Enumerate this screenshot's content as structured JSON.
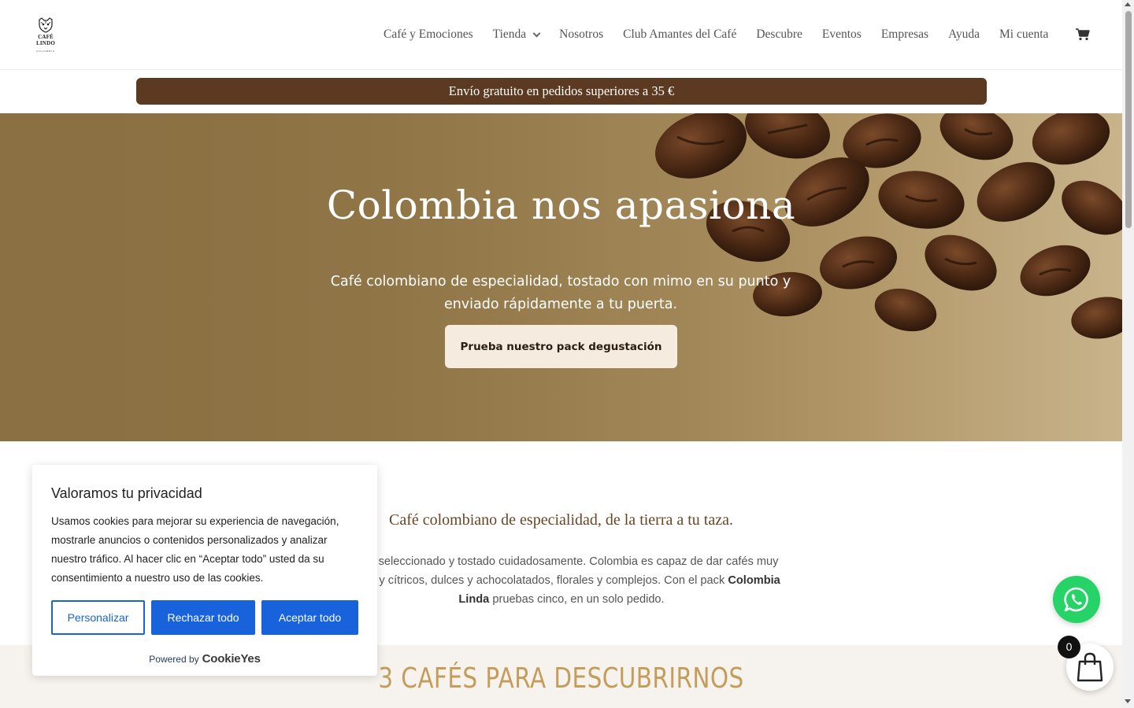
{
  "header": {
    "logo": {
      "brand": "CAFÉ LINDO",
      "sub": "COLOMBIA"
    },
    "nav": [
      {
        "label": "Café y Emociones"
      },
      {
        "label": "Tienda",
        "has_dropdown": true
      },
      {
        "label": "Nosotros"
      },
      {
        "label": "Club Amantes del Café"
      },
      {
        "label": "Descubre"
      },
      {
        "label": "Eventos"
      },
      {
        "label": "Empresas"
      },
      {
        "label": "Ayuda"
      },
      {
        "label": "Mi cuenta"
      }
    ],
    "cart_icon": "shopping-cart-icon"
  },
  "banner": {
    "text": "Envío gratuito en pedidos superiores a 35 €",
    "color": "#5c3a21"
  },
  "hero": {
    "title": "Colombia nos apasiona",
    "subtitle": "Café colombiano de especialidad, tostado con mimo en su punto y enviado rápidamente a tu puerta.",
    "cta_label": "Prueba nuestro pack degustación"
  },
  "intro": {
    "title": "Café colombiano de especialidad, de la tierra a tu taza.",
    "text_line1": "a sido seleccionado y tostado cuidadosamente. Colombia es capaz de dar cafés muy",
    "text_line2_pre": "llantes y cítricos, dulces y achocolatados, florales y complejos. Con el pack ",
    "text_line2_bold": "Colombia",
    "text_line3_bold": "Linda",
    "text_line3_post": " pruebas cinco, en un solo pedido."
  },
  "section_cafes": {
    "title": "3 CAFÉS PARA DESCUBRIRNOS",
    "color": "#c59d5a"
  },
  "cookie": {
    "title": "Valoramos tu privacidad",
    "description": "Usamos cookies para mejorar su experiencia de navegación, mostrarle anuncios o contenidos personalizados y analizar nuestro tráfico. Al hacer clic en “Aceptar todo” usted da su consentimiento a nuestro uso de las cookies.",
    "customize_label": "Personalizar",
    "reject_label": "Rechazar todo",
    "accept_label": "Aceptar todo",
    "powered_by": "Powered by",
    "powered_brand": "CookieYes",
    "accent": "#1863dc"
  },
  "whatsapp": {
    "icon": "whatsapp-icon",
    "color": "#25d366"
  },
  "cart_widget": {
    "icon": "shopping-bag-icon",
    "count": "0"
  }
}
